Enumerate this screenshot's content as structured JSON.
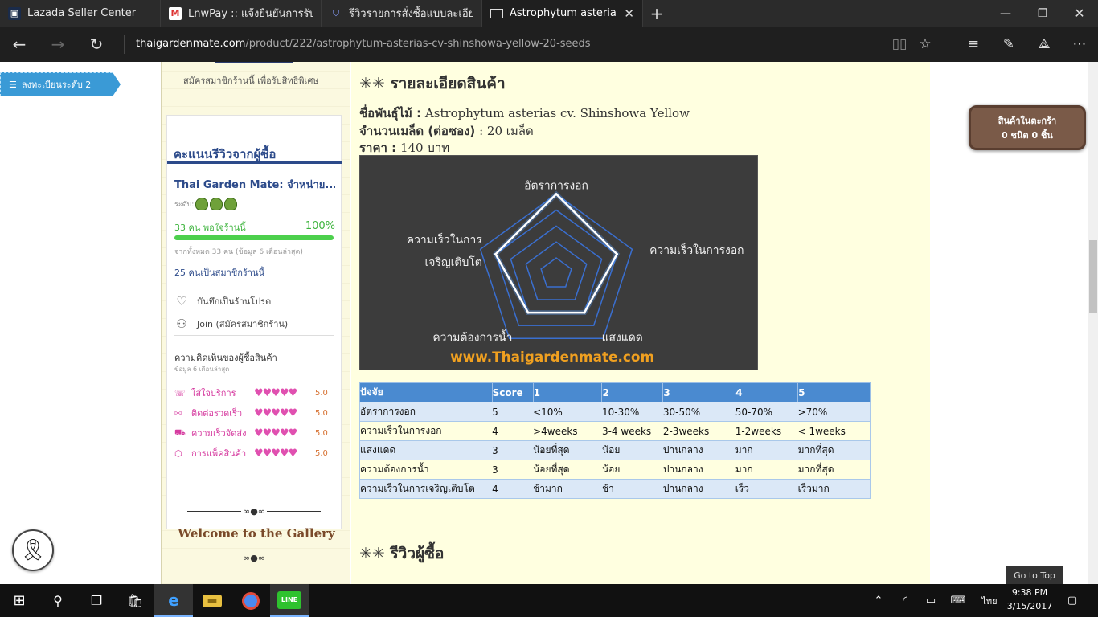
{
  "browser": {
    "tabs": [
      {
        "title": "Lazada Seller Center",
        "icon": "lazada-icon",
        "active": false
      },
      {
        "title": "LnwPay :: แจ้งยืนยันการรับสินค้",
        "icon": "gmail-icon",
        "active": false
      },
      {
        "title": "รีวิวรายการสั่งซื้อแบบละเอียด - L",
        "icon": "shield-icon",
        "active": false
      },
      {
        "title": "Astrophytum asterias cv",
        "icon": "page-icon",
        "active": true
      }
    ],
    "url_host": "thaigardenmate.com",
    "url_path": "/product/222/astrophytum-asterias-cv-shinshowa-yellow-20-seeds"
  },
  "sidebar": {
    "badge": "ลงทะเบียนระดับ 2",
    "signup_text": "สมัครสมาชิกร้านนี้ เพื่อรับสิทธิพิเศษ",
    "review_title": "คะแนนรีวิวจากผู้ซื้อ",
    "shop_name": "Thai Garden Mate: จำหน่าย...",
    "level_label": "ระดับ:",
    "satisfaction_text": "33 คน พอใจร้านนี้",
    "satisfaction_pct": "100%",
    "satisfaction_fraction": 1.0,
    "from_text": "จากทั้งหมด 33 คน (ข้อมูล 6 เดือนล่าสุด)",
    "members_text": "25 คนเป็นสมาชิกร้านนี้",
    "favorite_label": "บันทึกเป็นร้านโปรด",
    "join_label": "Join (สมัครสมาชิกร้าน)",
    "opinion_title": "ความคิดเห็นของผู้ซื้อสินค้า",
    "opinion_sub": "ข้อมูล 6 เดือนล่าสุด",
    "opinions": [
      {
        "label": "ใส่ใจบริการ",
        "score": "5.0",
        "icon": "chat-icon"
      },
      {
        "label": "ติดต่อรวดเร็ว",
        "score": "5.0",
        "icon": "mail-icon"
      },
      {
        "label": "ความเร็วจัดส่ง",
        "score": "5.0",
        "icon": "truck-icon"
      },
      {
        "label": "การแพ็คสินค้า",
        "score": "5.0",
        "icon": "box-icon"
      }
    ],
    "gallery_title": "Welcome to the Gallery"
  },
  "main": {
    "heading": "✳✳ รายละเอียดสินค้า",
    "species_label": "ชื่อพันธุ์ไม้ :",
    "species_value": "Astrophytum asterias cv. Shinshowa Yellow",
    "seeds_label": "จำนวนเมล็ด (ต่อซอง)",
    "seeds_value": ": 20 เมล็ด",
    "price_label": "ราคา :",
    "price_value": "140 บาท",
    "reviews_heading": "✳✳ รีวิวผู้ซื้อ"
  },
  "chart_data": {
    "type": "radar",
    "axes": [
      "อัตราการงอก",
      "ความเร็วในการงอก",
      "แสงแดด",
      "ความต้องการน้ำ",
      "ความเร็วในการเจริญเติบโต"
    ],
    "axis_labels_display": [
      "อัตราการงอก",
      "ความเร็วในการงอก",
      "แสงแดด",
      "ความต้องการน้ำ",
      "ความเร็วในการ|เจริญเติบโต"
    ],
    "values": [
      5,
      4,
      3,
      3,
      4
    ],
    "max": 5,
    "watermark": "www.Thaigardenmate.com",
    "colors": {
      "grid": "#3a6fd0",
      "series": "#ffffff",
      "bg": "#3c3c3c",
      "watermark": "#f0a020"
    }
  },
  "factor_table": {
    "headers": [
      "ปัจจัย",
      "Score",
      "1",
      "2",
      "3",
      "4",
      "5"
    ],
    "rows": [
      [
        "อัตราการงอก",
        "5",
        "<10%",
        "10-30%",
        "30-50%",
        "50-70%",
        ">70%"
      ],
      [
        "ความเร็วในการงอก",
        "4",
        ">4weeks",
        "3-4 weeks",
        "2-3weeks",
        "1-2weeks",
        "< 1weeks"
      ],
      [
        "แสงแดด",
        "3",
        "น้อยที่สุด",
        "น้อย",
        "ปานกลาง",
        "มาก",
        "มากที่สุด"
      ],
      [
        "ความต้องการน้ำ",
        "3",
        "น้อยที่สุด",
        "น้อย",
        "ปานกลาง",
        "มาก",
        "มากที่สุด"
      ],
      [
        "ความเร็วในการเจริญเติบโต",
        "4",
        "ช้ามาก",
        "ช้า",
        "ปานกลาง",
        "เร็ว",
        "เร็วมาก"
      ]
    ]
  },
  "cart": {
    "line1": "สินค้าในตะกร้า",
    "line2": "0 ชนิด 0 ชิ้น"
  },
  "go_top": "Go to Top",
  "taskbar": {
    "lang": "ไทย",
    "time": "9:38 PM",
    "date": "3/15/2017"
  }
}
